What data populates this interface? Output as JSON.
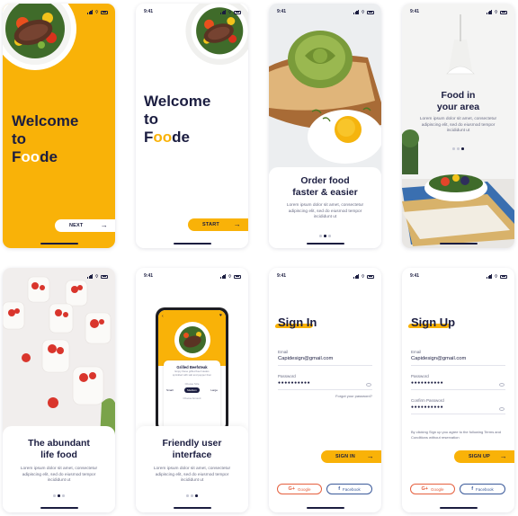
{
  "status_time": "9:41",
  "brand": {
    "yellow": "#f9b208",
    "navy": "#1b1d40"
  },
  "screens": {
    "welcome_yellow": {
      "line1": "Welcome",
      "line2": "to",
      "brand_f": "F",
      "brand_oo": "oo",
      "brand_de": "de",
      "button_label": "NEXT"
    },
    "welcome_white": {
      "line1": "Welcome",
      "line2": "to",
      "brand_f": "F",
      "brand_oo": "oo",
      "brand_de": "de",
      "button_label": "START"
    },
    "order": {
      "title_1": "Order food",
      "title_2": "faster & easier",
      "subtitle": "Lorem ipsum dolor sit amet, consectetur adipiscing elit, sed do eiusmod tempor incididunt ut"
    },
    "area": {
      "title_1": "Food in",
      "title_2": "your area",
      "subtitle": "Lorem ipsum dolor sit amet, consectetur adipiscing elit, sed do eiusmod tempor incididunt ut"
    },
    "abundant": {
      "title_1": "The abundant",
      "title_2": "life food",
      "subtitle": "Lorem ipsum dolor sit amet, consectetur adipiscing elit, sed do eiusmod tempor incididunt ut"
    },
    "friendly": {
      "title_1": "Friendly user",
      "title_2": "interface",
      "subtitle": "Lorem ipsum dolor sit amet, consectetur adipiscing elit, sed do eiusmod tempor incididunt ut",
      "mock_dish": "Grilled Beefsteak",
      "mock_desc": "Enjoy these grilled beef steaks sprinkled with salt and pepper then",
      "choose_size": "Choose Size",
      "sizes": [
        "Small",
        "Medium",
        "Large"
      ],
      "choose_amount": "Choose Amount"
    },
    "sign_in": {
      "title": "Sign In",
      "email_label": "Email",
      "email_value": "Capidesign@gmail.com",
      "password_label": "Password",
      "password_value": "●●●●●●●●●●",
      "forgot": "Forgot your password?",
      "button_label": "SIGN IN",
      "google": "Google",
      "facebook": "Facebook"
    },
    "sign_up": {
      "title": "Sign Up",
      "email_label": "Email",
      "email_value": "Capidesign@gmail.com",
      "password_label": "Password",
      "password_value": "●●●●●●●●●●",
      "confirm_label": "Confirm Password",
      "confirm_value": "●●●●●●●●●●",
      "terms": "By clicking Sign up you agree to the following Terms and Conditions without reservation",
      "button_label": "SIGN UP",
      "google": "Google",
      "facebook": "Facebook"
    }
  }
}
